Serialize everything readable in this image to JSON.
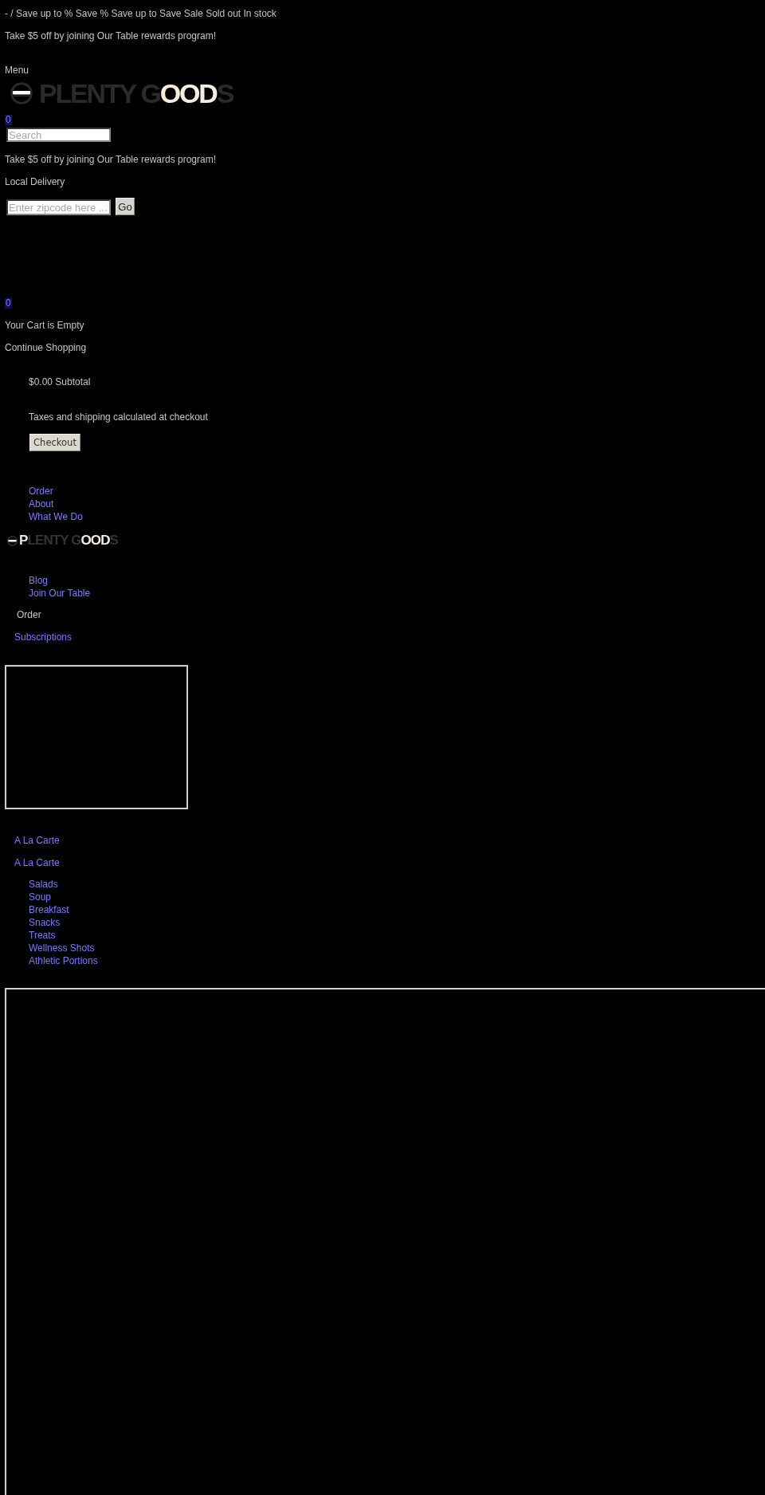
{
  "announcement": {
    "text": "- / Save up to % Save % Save up to Save Sale Sold out In stock"
  },
  "promo_top": {
    "text": "Take $5 off by joining Our Table rewards program!"
  },
  "header": {
    "menu_label": "Menu",
    "logo": {
      "parts": [
        {
          "text": "PLENTY G",
          "color": "#2a2a2a"
        },
        {
          "text": "OOD",
          "color": "#f4eedf"
        },
        {
          "text": "S",
          "color": "#2a2a2a"
        }
      ]
    },
    "cart_count": "0",
    "search": {
      "placeholder": "Search"
    }
  },
  "promo": {
    "text": "Take $5 off by joining Our Table rewards program!"
  },
  "local_delivery": {
    "title": "Local Delivery",
    "zipcode": {
      "placeholder": "Enter zipcode here ..."
    },
    "button": "Go"
  },
  "cart": {
    "count": "0",
    "empty_message": "Your Cart is Empty",
    "continue_link": "Continue Shopping",
    "subtotal": "$0.00 Subtotal",
    "note": "Taxes and shipping calculated at checkout",
    "checkout_button": "Checkout"
  },
  "footer_nav": {
    "links": [
      "Order",
      "About",
      "What We Do"
    ]
  },
  "footer_logo": {
    "parts": [
      {
        "text": "P",
        "color": "#e6e6e6"
      },
      {
        "text": "LENTY G",
        "color": "#333333"
      },
      {
        "text": "OOD",
        "color": "#f4eedf"
      },
      {
        "text": "S",
        "color": "#333333"
      }
    ]
  },
  "footer_links": [
    "Blog",
    "Join Our Table"
  ],
  "order_menu": {
    "title": "Order",
    "subscriptions_link": "Subscriptions",
    "a_la_carte_links": [
      "A La Carte",
      "A La Carte"
    ],
    "categories": [
      "Salads",
      "Soup",
      "Breakfast",
      "Snacks",
      "Treats",
      "Wellness Shots",
      "Athletic Portions"
    ]
  }
}
